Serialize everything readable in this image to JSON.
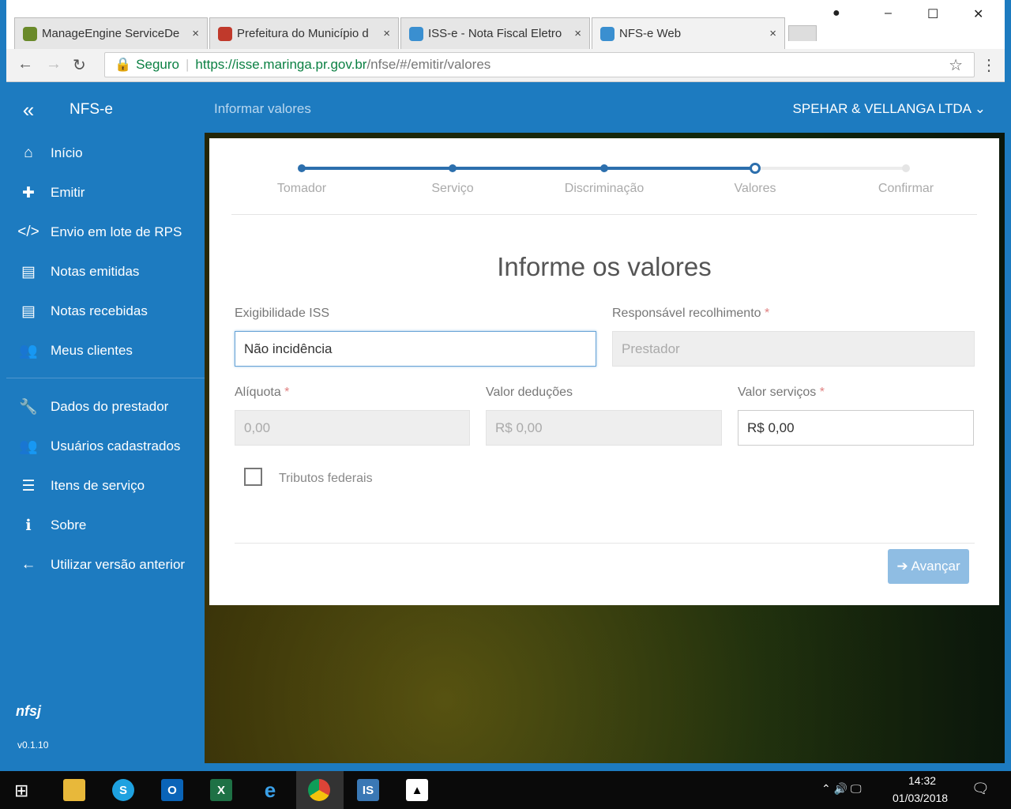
{
  "browser": {
    "tabs": [
      {
        "title": "ManageEngine ServiceDe",
        "color": "#6a8a2a"
      },
      {
        "title": "Prefeitura do Município d",
        "color": "#c0392b"
      },
      {
        "title": "ISS-e - Nota Fiscal Eletro",
        "color": "#3a8fd0"
      },
      {
        "title": "NFS-e Web",
        "color": "#3a8fd0"
      }
    ],
    "close": "×",
    "secure_label": "Seguro",
    "url_host": "https://isse.maringa.pr.gov.br",
    "url_path": "/nfse/#/emitir/valores"
  },
  "app": {
    "brand": "NFS-e",
    "page_title": "Informar valores",
    "company": "SPEHAR & VELLANGA LTDA",
    "version": "v0.1.10",
    "logo_text": "nfsj"
  },
  "sidebar": {
    "items": [
      {
        "label": "Início",
        "icon": "⌂"
      },
      {
        "label": "Emitir",
        "icon": "✚"
      },
      {
        "label": "Envio em lote de RPS",
        "icon": "</>"
      },
      {
        "label": "Notas emitidas",
        "icon": "▤"
      },
      {
        "label": "Notas recebidas",
        "icon": "▤"
      },
      {
        "label": "Meus clientes",
        "icon": "👥"
      },
      {
        "label": "Dados do prestador",
        "icon": "🔧"
      },
      {
        "label": "Usuários cadastrados",
        "icon": "👥"
      },
      {
        "label": "Itens de serviço",
        "icon": "☰"
      },
      {
        "label": "Sobre",
        "icon": "ℹ"
      },
      {
        "label": "Utilizar versão anterior",
        "icon": "←"
      }
    ]
  },
  "steps": [
    "Tomador",
    "Serviço",
    "Discriminação",
    "Valores",
    "Confirmar"
  ],
  "current_step": 4,
  "form": {
    "heading": "Informe os valores",
    "exigibilidade_label": "Exigibilidade ISS",
    "exigibilidade_value": "Não incidência",
    "responsavel_label": "Responsável recolhimento",
    "responsavel_value": "Prestador",
    "aliquota_label": "Alíquota",
    "aliquota_value": "0,00",
    "deducoes_label": "Valor deduções",
    "deducoes_value": "R$ 0,00",
    "servicos_label": "Valor serviços",
    "servicos_value": "R$ 0,00",
    "required_mark": "*",
    "tributos_label": "Tributos federais",
    "next_label": "Avançar"
  },
  "taskbar": {
    "time": "14:32",
    "date": "01/03/2018"
  }
}
